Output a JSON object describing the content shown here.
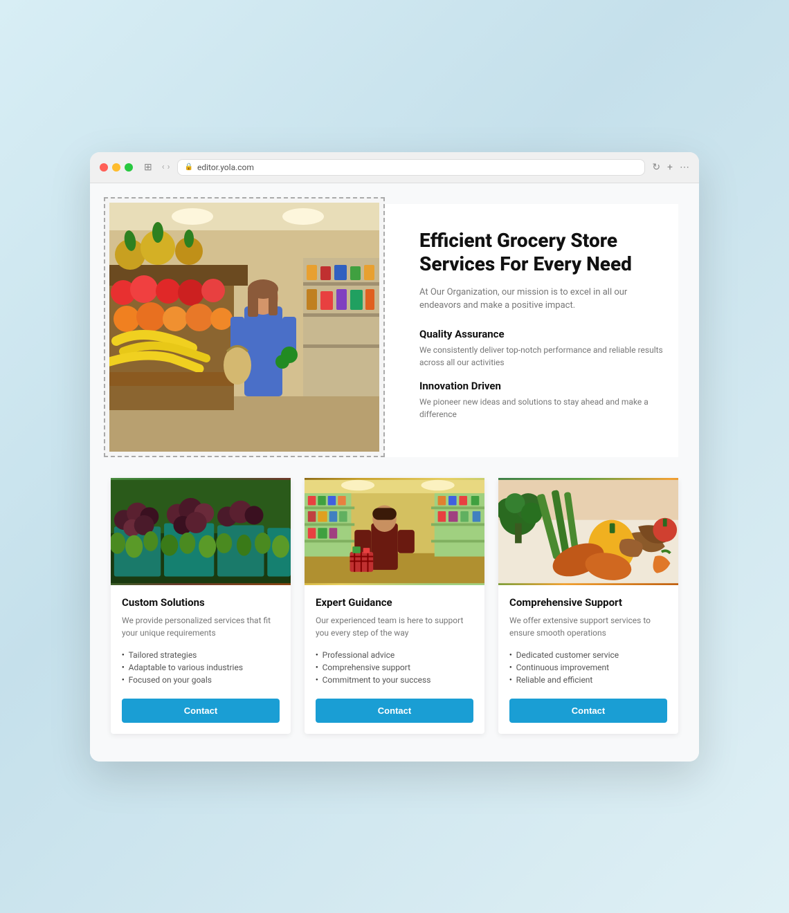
{
  "browser": {
    "url": "editor.yola.com",
    "traffic_lights": [
      "red",
      "yellow",
      "green"
    ]
  },
  "hero": {
    "title": "Efficient Grocery Store Services For Every Need",
    "subtitle": "At Our Organization, our mission is to excel in all our endeavors and make a positive impact.",
    "features": [
      {
        "title": "Quality Assurance",
        "desc": "We consistently deliver top-notch performance and reliable results across all our activities"
      },
      {
        "title": "Innovation Driven",
        "desc": "We pioneer new ideas and solutions to stay ahead and make a difference"
      }
    ]
  },
  "cards": [
    {
      "title": "Custom Solutions",
      "desc": "We provide personalized services that fit your unique requirements",
      "list": [
        "Tailored strategies",
        "Adaptable to various industries",
        "Focused on your goals"
      ],
      "button": "Contact",
      "img_type": "figs"
    },
    {
      "title": "Expert Guidance",
      "desc": "Our experienced team is here to support you every step of the way",
      "list": [
        "Professional advice",
        "Comprehensive support",
        "Commitment to your success"
      ],
      "button": "Contact",
      "img_type": "store"
    },
    {
      "title": "Comprehensive Support",
      "desc": "We offer extensive support services to ensure smooth operations",
      "list": [
        "Dedicated customer service",
        "Continuous improvement",
        "Reliable and efficient"
      ],
      "button": "Contact",
      "img_type": "veggies"
    }
  ]
}
